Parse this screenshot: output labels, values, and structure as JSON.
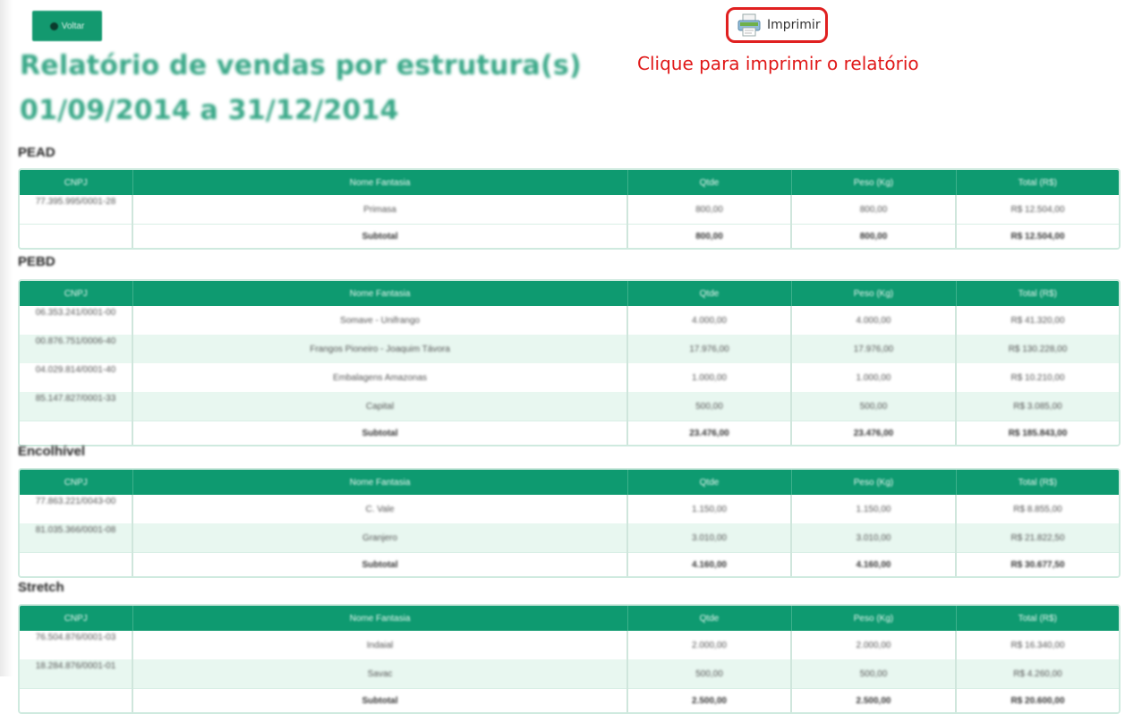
{
  "toolbar": {
    "back_label": "Voltar",
    "print_label": "Imprimir",
    "print_hint": "Clique para imprimir o relatório"
  },
  "report": {
    "title": "Relatório de vendas por estrutura(s)",
    "period": "01/09/2014 a 31/12/2014"
  },
  "columns": [
    "CNPJ",
    "Nome Fantasia",
    "Qtde",
    "Peso (Kg)",
    "Total (R$)"
  ],
  "sections": [
    {
      "name": "PEAD",
      "rows": [
        {
          "cnpj": "77.395.995/0001-28",
          "nome": "Primasa",
          "qtde": "800,00",
          "peso": "800,00",
          "total": "R$ 12.504,00"
        }
      ],
      "subtotal": {
        "label": "Subtotal",
        "qtde": "800,00",
        "peso": "800,00",
        "total": "R$ 12.504,00"
      }
    },
    {
      "name": "PEBD",
      "rows": [
        {
          "cnpj": "06.353.241/0001-00",
          "nome": "Somave - Unifrango",
          "qtde": "4.000,00",
          "peso": "4.000,00",
          "total": "R$ 41.320,00"
        },
        {
          "cnpj": "00.876.751/0006-40",
          "nome": "Frangos Pioneiro - Joaquim Távora",
          "qtde": "17.976,00",
          "peso": "17.976,00",
          "total": "R$ 130.228,00"
        },
        {
          "cnpj": "04.029.814/0001-40",
          "nome": "Embalagens Amazonas",
          "qtde": "1.000,00",
          "peso": "1.000,00",
          "total": "R$ 10.210,00"
        },
        {
          "cnpj": "85.147.827/0001-33",
          "nome": "Capital",
          "qtde": "500,00",
          "peso": "500,00",
          "total": "R$ 3.085,00"
        }
      ],
      "subtotal": {
        "label": "Subtotal",
        "qtde": "23.476,00",
        "peso": "23.476,00",
        "total": "R$ 185.843,00"
      }
    },
    {
      "name": "Encolhível",
      "rows": [
        {
          "cnpj": "77.863.221/0043-00",
          "nome": "C. Vale",
          "qtde": "1.150,00",
          "peso": "1.150,00",
          "total": "R$ 8.855,00"
        },
        {
          "cnpj": "81.035.366/0001-08",
          "nome": "Granjero",
          "qtde": "3.010,00",
          "peso": "3.010,00",
          "total": "R$ 21.822,50"
        }
      ],
      "subtotal": {
        "label": "Subtotal",
        "qtde": "4.160,00",
        "peso": "4.160,00",
        "total": "R$ 30.677,50"
      }
    },
    {
      "name": "Stretch",
      "rows": [
        {
          "cnpj": "76.504.876/0001-03",
          "nome": "Indaial",
          "qtde": "2.000,00",
          "peso": "2.000,00",
          "total": "R$ 16.340,00"
        },
        {
          "cnpj": "18.284.876/0001-01",
          "nome": "Savac",
          "qtde": "500,00",
          "peso": "500,00",
          "total": "R$ 4.260,00"
        }
      ],
      "subtotal": {
        "label": "Subtotal",
        "qtde": "2.500,00",
        "peso": "2.500,00",
        "total": "R$ 20.600,00"
      }
    }
  ]
}
